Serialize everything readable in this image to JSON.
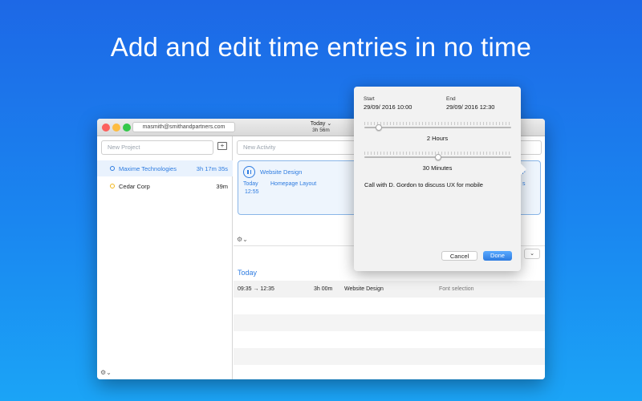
{
  "headline": "Add and edit time entries in no time",
  "colors": {
    "accent": "#2d7be0",
    "bg_top": "#1d68e6",
    "bg_bottom": "#1ba4f6"
  },
  "window": {
    "account_email": "masmith@smithandpartners.com",
    "title": "Today",
    "title_duration": "3h 56m",
    "chevron": "⌄"
  },
  "sidebar": {
    "new_project_placeholder": "New Project",
    "add_icon": "folder-plus-icon",
    "projects": [
      {
        "name": "Maxime Technologies",
        "time": "3h 17m 35s",
        "color": "#2d7be0",
        "selected": true
      },
      {
        "name": "Cedar Corp",
        "time": "39m",
        "color": "#f2b619",
        "selected": false
      }
    ],
    "gear_glyph": "⚙⌄"
  },
  "main": {
    "new_activity_placeholder": "New Activity",
    "running": {
      "activity": "Website Design",
      "day": "Today",
      "time": "12:55",
      "task": "Homepage Layout",
      "plus": "+",
      "side_glyph": "s"
    },
    "gear_glyph": "⚙⌄",
    "dropdown_glyph": "⌄",
    "section_title": "Today",
    "entries": [
      {
        "range": "09:35 → 12:35",
        "duration": "3h 00m",
        "activity": "Website Design",
        "description": "Font selection"
      }
    ]
  },
  "popover": {
    "start_label": "Start",
    "start_value": "29/09/ 2016  10:00",
    "end_label": "End",
    "end_value": "29/09/ 2016  12:30",
    "hours_value": "2 Hours",
    "hours_fraction": 0.1,
    "minutes_value": "30 Minutes",
    "minutes_fraction": 0.5,
    "note": "Call with D. Gordon to discuss UX for mobile",
    "cancel_label": "Cancel",
    "done_label": "Done"
  }
}
